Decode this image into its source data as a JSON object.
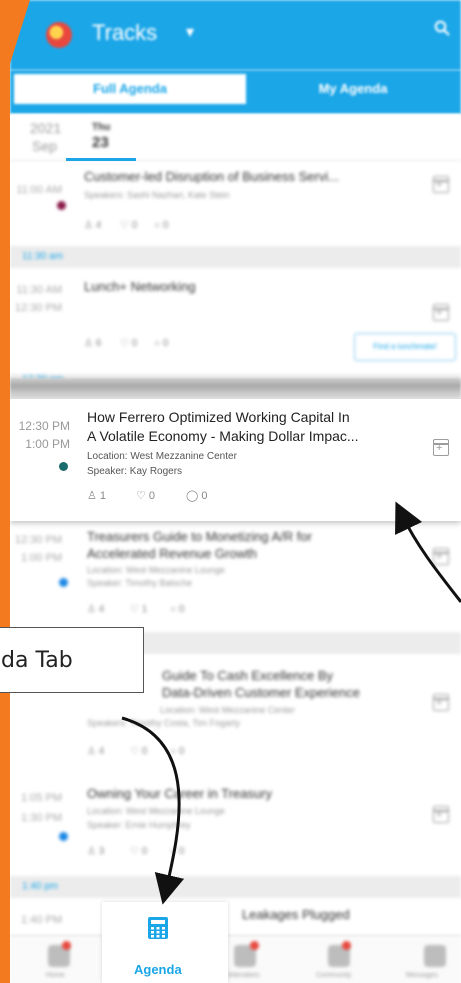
{
  "app": {
    "title": "Tracks",
    "title_caret": "▾"
  },
  "tabs": [
    {
      "label": "Full Agenda"
    },
    {
      "label": "My Agenda"
    }
  ],
  "date": {
    "year": "2021",
    "month": "Sep",
    "weekday": "Thu",
    "day": "23"
  },
  "colors": {
    "accent": "#1ba6e8",
    "frame": "#f47a20",
    "dot_maroon": "#8b1a4a",
    "dot_teal": "#1a6b6b",
    "dot_blue": "#1e88e5"
  },
  "sessions": [
    {
      "title": "Customer-led Disruption of Business Servi...",
      "speakers": "Speakers: Sashi Nazhari, Kate Stein",
      "time_start": "11:00 AM",
      "stats": [
        "4",
        "0",
        "0"
      ]
    },
    {
      "title": "Lunch+ Networking",
      "time_start": "11:30 AM",
      "time_end": "12:30 PM",
      "stats": [
        "6",
        "0",
        "0"
      ],
      "action": "Find a lunchmate!"
    },
    {
      "title_line1": "How Ferrero Optimized Working Capital In",
      "title_line2": "A Volatile Economy - Making Dollar Impac...",
      "location": "Location: West Mezzanine Center",
      "speaker": "Speaker: Kay Rogers",
      "time_start": "12:30 PM",
      "time_end": "1:00 PM",
      "stats": [
        "1",
        "0",
        "0"
      ]
    },
    {
      "title_line1": "Treasurers Guide to Monetizing A/R for",
      "title_line2": "Accelerated Revenue Growth",
      "location": "Location: West Mezzanine Lounge",
      "speaker": "Speaker: Timothy Batsche",
      "time_start": "12:30 PM",
      "time_end": "1:00 PM",
      "stats": [
        "4",
        "1",
        "0"
      ]
    },
    {
      "title_line1": "Guide To Cash Excellence By",
      "title_line2": "Data-Driven Customer Experience",
      "location": "Location: West Mezzanine Center",
      "speaker": "Speakers: Timothy Costa, Tim Fogarty",
      "stats": [
        "4",
        "0",
        "0"
      ]
    },
    {
      "title": "Owning Your Career in Treasury",
      "location": "Location: West Mezzanine Lounge",
      "speaker": "Speaker: Ernie Humphrey",
      "time_start": "1:05 PM",
      "time_end": "1:30 PM",
      "stats": [
        "3",
        "0",
        "0"
      ]
    },
    {
      "title": "Leakages Plugged",
      "time_start": "1:40 PM"
    }
  ],
  "sections": [
    "11:30 am",
    "12:30 pm",
    "1:40 pm"
  ],
  "callout": {
    "text": "da Tab"
  },
  "bottom_nav": {
    "active_label": "Agenda",
    "labels": [
      "Home",
      "Attendees",
      "Community",
      "Messages"
    ]
  }
}
